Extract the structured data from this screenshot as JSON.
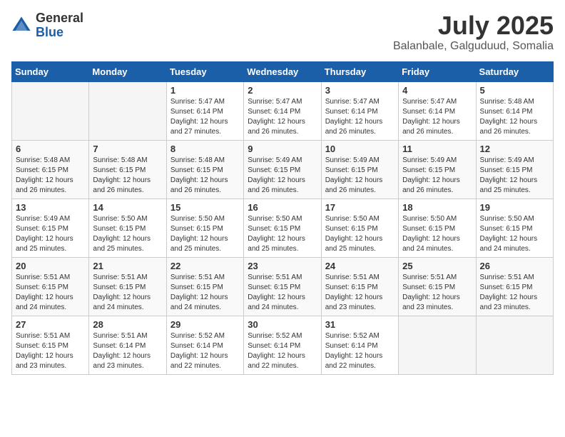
{
  "logo": {
    "general": "General",
    "blue": "Blue"
  },
  "header": {
    "month": "July 2025",
    "location": "Balanbale, Galguduud, Somalia"
  },
  "weekdays": [
    "Sunday",
    "Monday",
    "Tuesday",
    "Wednesday",
    "Thursday",
    "Friday",
    "Saturday"
  ],
  "weeks": [
    [
      {
        "day": "",
        "info": ""
      },
      {
        "day": "",
        "info": ""
      },
      {
        "day": "1",
        "info": "Sunrise: 5:47 AM\nSunset: 6:14 PM\nDaylight: 12 hours and 27 minutes."
      },
      {
        "day": "2",
        "info": "Sunrise: 5:47 AM\nSunset: 6:14 PM\nDaylight: 12 hours and 26 minutes."
      },
      {
        "day": "3",
        "info": "Sunrise: 5:47 AM\nSunset: 6:14 PM\nDaylight: 12 hours and 26 minutes."
      },
      {
        "day": "4",
        "info": "Sunrise: 5:47 AM\nSunset: 6:14 PM\nDaylight: 12 hours and 26 minutes."
      },
      {
        "day": "5",
        "info": "Sunrise: 5:48 AM\nSunset: 6:14 PM\nDaylight: 12 hours and 26 minutes."
      }
    ],
    [
      {
        "day": "6",
        "info": "Sunrise: 5:48 AM\nSunset: 6:15 PM\nDaylight: 12 hours and 26 minutes."
      },
      {
        "day": "7",
        "info": "Sunrise: 5:48 AM\nSunset: 6:15 PM\nDaylight: 12 hours and 26 minutes."
      },
      {
        "day": "8",
        "info": "Sunrise: 5:48 AM\nSunset: 6:15 PM\nDaylight: 12 hours and 26 minutes."
      },
      {
        "day": "9",
        "info": "Sunrise: 5:49 AM\nSunset: 6:15 PM\nDaylight: 12 hours and 26 minutes."
      },
      {
        "day": "10",
        "info": "Sunrise: 5:49 AM\nSunset: 6:15 PM\nDaylight: 12 hours and 26 minutes."
      },
      {
        "day": "11",
        "info": "Sunrise: 5:49 AM\nSunset: 6:15 PM\nDaylight: 12 hours and 26 minutes."
      },
      {
        "day": "12",
        "info": "Sunrise: 5:49 AM\nSunset: 6:15 PM\nDaylight: 12 hours and 25 minutes."
      }
    ],
    [
      {
        "day": "13",
        "info": "Sunrise: 5:49 AM\nSunset: 6:15 PM\nDaylight: 12 hours and 25 minutes."
      },
      {
        "day": "14",
        "info": "Sunrise: 5:50 AM\nSunset: 6:15 PM\nDaylight: 12 hours and 25 minutes."
      },
      {
        "day": "15",
        "info": "Sunrise: 5:50 AM\nSunset: 6:15 PM\nDaylight: 12 hours and 25 minutes."
      },
      {
        "day": "16",
        "info": "Sunrise: 5:50 AM\nSunset: 6:15 PM\nDaylight: 12 hours and 25 minutes."
      },
      {
        "day": "17",
        "info": "Sunrise: 5:50 AM\nSunset: 6:15 PM\nDaylight: 12 hours and 25 minutes."
      },
      {
        "day": "18",
        "info": "Sunrise: 5:50 AM\nSunset: 6:15 PM\nDaylight: 12 hours and 24 minutes."
      },
      {
        "day": "19",
        "info": "Sunrise: 5:50 AM\nSunset: 6:15 PM\nDaylight: 12 hours and 24 minutes."
      }
    ],
    [
      {
        "day": "20",
        "info": "Sunrise: 5:51 AM\nSunset: 6:15 PM\nDaylight: 12 hours and 24 minutes."
      },
      {
        "day": "21",
        "info": "Sunrise: 5:51 AM\nSunset: 6:15 PM\nDaylight: 12 hours and 24 minutes."
      },
      {
        "day": "22",
        "info": "Sunrise: 5:51 AM\nSunset: 6:15 PM\nDaylight: 12 hours and 24 minutes."
      },
      {
        "day": "23",
        "info": "Sunrise: 5:51 AM\nSunset: 6:15 PM\nDaylight: 12 hours and 24 minutes."
      },
      {
        "day": "24",
        "info": "Sunrise: 5:51 AM\nSunset: 6:15 PM\nDaylight: 12 hours and 23 minutes."
      },
      {
        "day": "25",
        "info": "Sunrise: 5:51 AM\nSunset: 6:15 PM\nDaylight: 12 hours and 23 minutes."
      },
      {
        "day": "26",
        "info": "Sunrise: 5:51 AM\nSunset: 6:15 PM\nDaylight: 12 hours and 23 minutes."
      }
    ],
    [
      {
        "day": "27",
        "info": "Sunrise: 5:51 AM\nSunset: 6:15 PM\nDaylight: 12 hours and 23 minutes."
      },
      {
        "day": "28",
        "info": "Sunrise: 5:51 AM\nSunset: 6:14 PM\nDaylight: 12 hours and 23 minutes."
      },
      {
        "day": "29",
        "info": "Sunrise: 5:52 AM\nSunset: 6:14 PM\nDaylight: 12 hours and 22 minutes."
      },
      {
        "day": "30",
        "info": "Sunrise: 5:52 AM\nSunset: 6:14 PM\nDaylight: 12 hours and 22 minutes."
      },
      {
        "day": "31",
        "info": "Sunrise: 5:52 AM\nSunset: 6:14 PM\nDaylight: 12 hours and 22 minutes."
      },
      {
        "day": "",
        "info": ""
      },
      {
        "day": "",
        "info": ""
      }
    ]
  ]
}
